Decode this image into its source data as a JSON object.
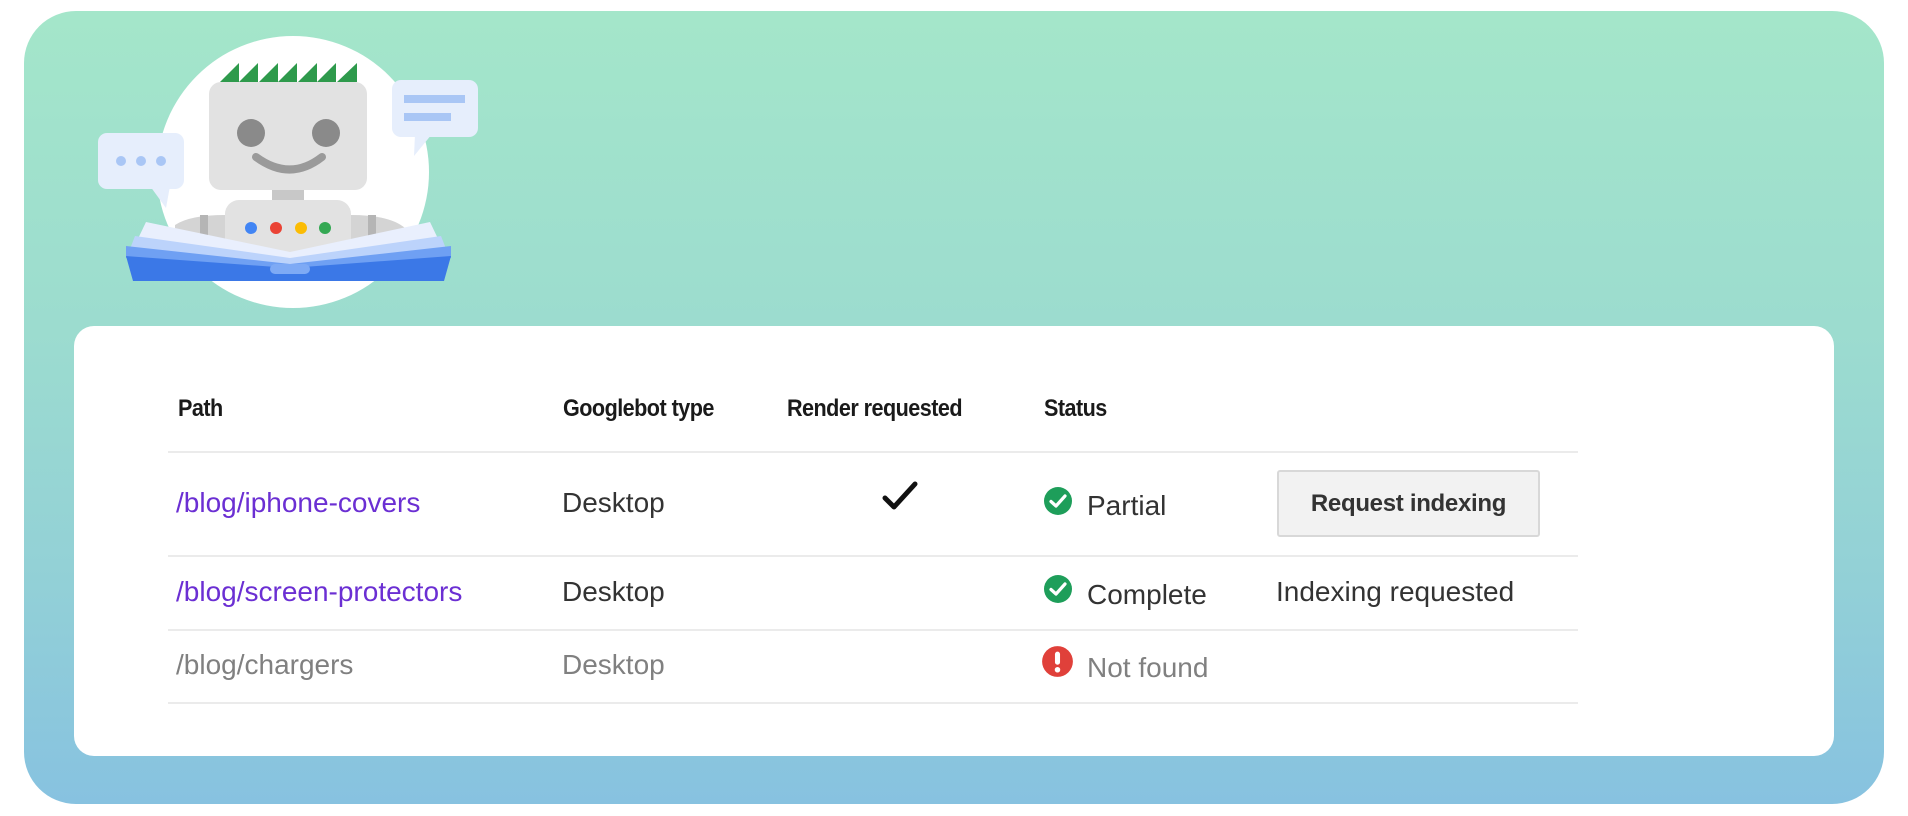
{
  "illustration": {
    "name": "Googlebot reading a book",
    "colors": {
      "hair": "#34a853",
      "head": "#e2e2e2",
      "eyes": "#8a8a8a",
      "book": "#3b78e7",
      "book_pages": "#cfdefb",
      "bubble": "#e3ecfb",
      "bubble_marks": "#a9c6f5",
      "dot_blue": "#4285f4",
      "dot_red": "#ea4335",
      "dot_yellow": "#fbbc04",
      "dot_green": "#34a853"
    }
  },
  "table": {
    "headers": {
      "path": "Path",
      "googlebot_type": "Googlebot type",
      "render_requested": "Render requested",
      "status": "Status",
      "action": ""
    },
    "rows": [
      {
        "path": "/blog/iphone-covers",
        "googlebot_type": "Desktop",
        "render_requested": true,
        "render_icon": "checkmark-icon",
        "status": "Partial",
        "status_icon": "check-circle-icon",
        "action_type": "button",
        "action_label": "Request indexing"
      },
      {
        "path": "/blog/screen-protectors",
        "googlebot_type": "Desktop",
        "render_requested": false,
        "status": "Complete",
        "status_icon": "check-circle-icon",
        "action_type": "text",
        "action_label": "Indexing requested"
      },
      {
        "path": "/blog/chargers",
        "googlebot_type": "Desktop",
        "render_requested": false,
        "status": "Not found",
        "status_icon": "error-circle-icon",
        "action_type": "none",
        "action_label": ""
      }
    ]
  },
  "colors": {
    "link": "#6b2fd3",
    "success": "#1e9e5a",
    "error": "#e0403a",
    "muted_text": "#808080",
    "gradient_top": "#a4e6ca",
    "gradient_bottom": "#87c2e0"
  }
}
